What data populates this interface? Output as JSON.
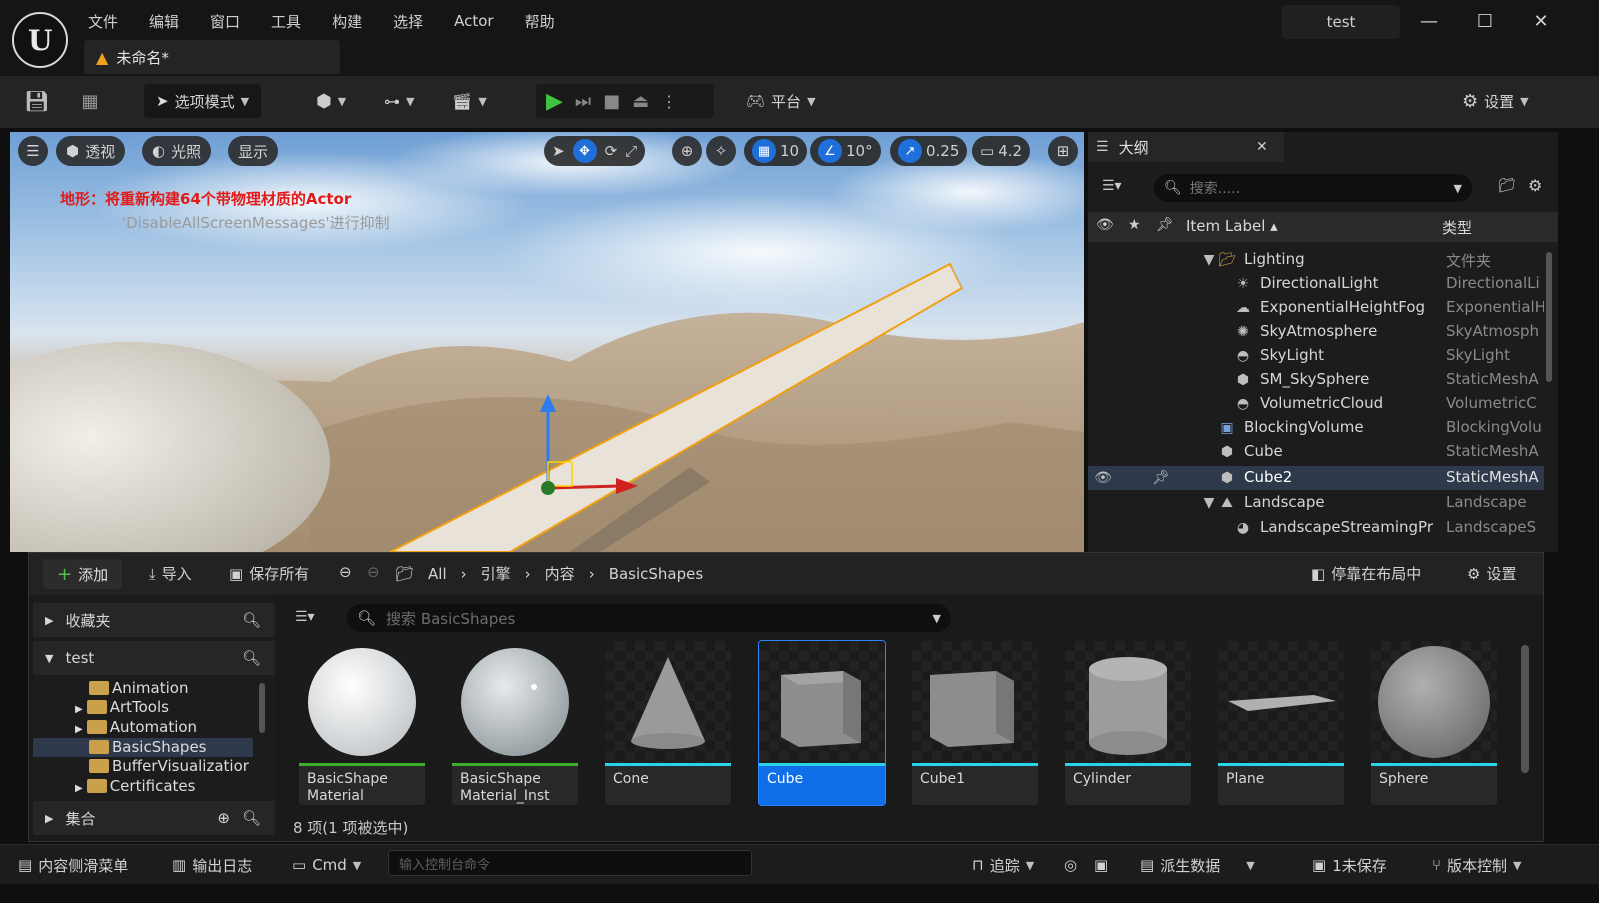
{
  "menu": [
    "文件",
    "编辑",
    "窗口",
    "工具",
    "构建",
    "选择",
    "Actor",
    "帮助"
  ],
  "document_tab": "未命名*",
  "project_name": "test",
  "toolbar": {
    "mode_label": "选项模式",
    "platform_label": "平台",
    "settings_label": "设置"
  },
  "viewport": {
    "perspective_label": "透视",
    "lighting_label": "光照",
    "show_label": "显示",
    "grid_snap": "10",
    "rotation_snap": "10°",
    "scale_snap": "0.25",
    "camera_speed": "4.2",
    "message_error": "地形：将重新构建64个带物理材质的Actor",
    "message_hint": "'DisableAllScreenMessages'进行抑制"
  },
  "outliner": {
    "title": "大纲",
    "search_placeholder": "搜索.....",
    "col_label": "Item Label ▴",
    "col_type": "类型",
    "rows": [
      {
        "label": "Lighting",
        "type": "文件夹"
      },
      {
        "label": "DirectionalLight",
        "type": "DirectionalLi"
      },
      {
        "label": "ExponentialHeightFog",
        "type": "ExponentialH"
      },
      {
        "label": "SkyAtmosphere",
        "type": "SkyAtmosph"
      },
      {
        "label": "SkyLight",
        "type": "SkyLight"
      },
      {
        "label": "SM_SkySphere",
        "type": "StaticMeshA"
      },
      {
        "label": "VolumetricCloud",
        "type": "VolumetricC"
      },
      {
        "label": "BlockingVolume",
        "type": "BlockingVolu"
      },
      {
        "label": "Cube",
        "type": "StaticMeshA"
      },
      {
        "label": "Cube2",
        "type": "StaticMeshA"
      },
      {
        "label": "Landscape",
        "type": "Landscape"
      },
      {
        "label": "LandscapeStreamingPr",
        "type": "LandscapeS"
      }
    ]
  },
  "content_browser": {
    "add_label": "添加",
    "import_label": "导入",
    "save_all_label": "保存所有",
    "path": [
      "All",
      "引擎",
      "内容",
      "BasicShapes"
    ],
    "dock_label": "停靠在布局中",
    "settings_label": "设置",
    "favorites_label": "收藏夹",
    "project_root": "test",
    "collections_label": "集合",
    "folders": [
      "Animation",
      "ArtTools",
      "Automation",
      "BasicShapes",
      "BufferVisualizatior",
      "Certificates"
    ],
    "search_placeholder": "搜索 BasicShapes",
    "assets": [
      {
        "name": "BasicShape Material",
        "bar_color": "#3fae2a"
      },
      {
        "name": "BasicShape Material_Inst",
        "bar_color": "#3fae2a"
      },
      {
        "name": "Cone",
        "bar_color": "#2ad4e8"
      },
      {
        "name": "Cube",
        "bar_color": "#2ad4e8"
      },
      {
        "name": "Cube1",
        "bar_color": "#2ad4e8"
      },
      {
        "name": "Cylinder",
        "bar_color": "#2ad4e8"
      },
      {
        "name": "Plane",
        "bar_color": "#2ad4e8"
      },
      {
        "name": "Sphere",
        "bar_color": "#2ad4e8"
      }
    ],
    "status": "8 项(1 项被选中)"
  },
  "statusbar": {
    "content_drawer": "内容侧滑菜单",
    "output_log": "输出日志",
    "cmd_label": "Cmd",
    "console_placeholder": "输入控制台命令",
    "trace_label": "追踪",
    "derived_data": "派生数据",
    "unsaved": "1未保存",
    "source_control": "版本控制"
  }
}
